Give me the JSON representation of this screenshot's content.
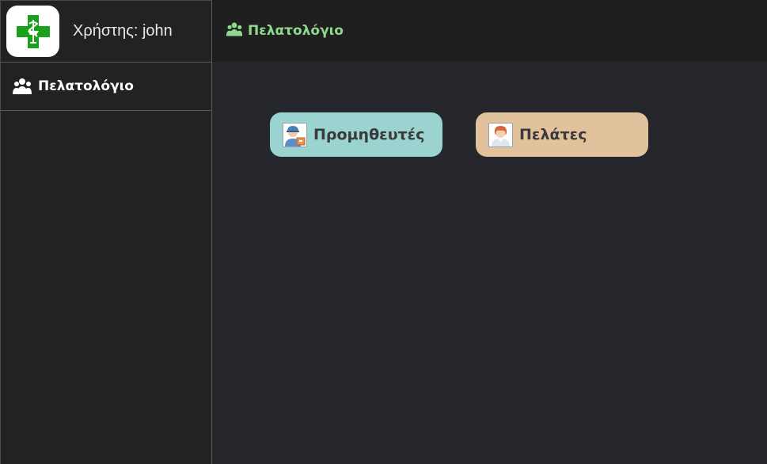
{
  "user": {
    "label": "Χρήστης: john"
  },
  "sidebar": {
    "items": [
      {
        "label": "Πελατολόγιο",
        "icon": "users-icon"
      }
    ]
  },
  "topbar": {
    "title": "Πελατολόγιο",
    "icon": "users-icon",
    "title_color": "#8fd98f"
  },
  "main": {
    "buttons": [
      {
        "label": "Προμηθευτές",
        "icon": "supplier-icon",
        "color": "#9ad3cf"
      },
      {
        "label": "Πελάτες",
        "icon": "customer-icon",
        "color": "#e2c29c"
      }
    ]
  },
  "colors": {
    "logo_cross": "#1aa01a",
    "sidebar_bg": "#222222",
    "content_bg": "#25272c"
  }
}
